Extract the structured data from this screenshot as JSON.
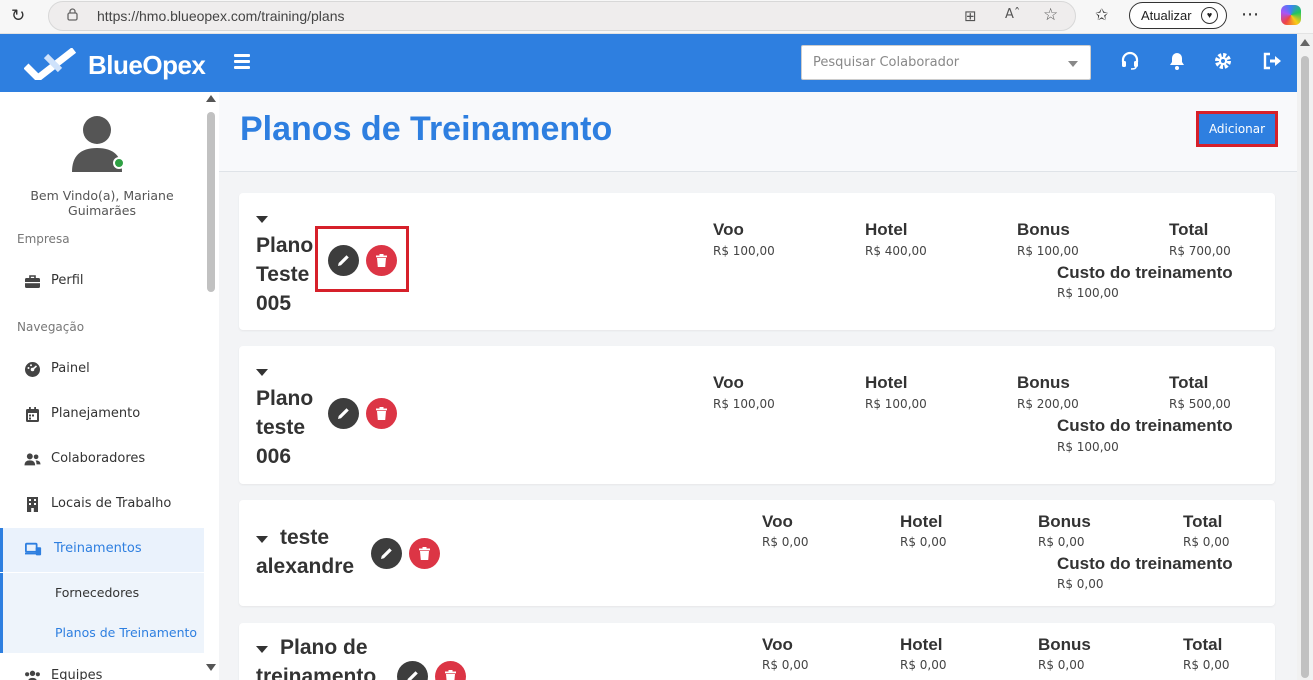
{
  "browser": {
    "url": "https://hmo.blueopex.com/training/plans",
    "update_label": "Atualizar"
  },
  "header": {
    "logo_text": "BlueOpex",
    "search_placeholder": "Pesquisar Colaborador",
    "icons": [
      "headset-icon",
      "bell-icon",
      "gear-icon",
      "logout-icon"
    ]
  },
  "sidebar": {
    "welcome": "Bem Vindo(a), Mariane Guimarães",
    "section_company": "Empresa",
    "section_nav": "Navegação",
    "items": [
      {
        "label": "Perfil",
        "icon": "briefcase-icon"
      },
      {
        "label": "Painel",
        "icon": "dashboard-icon"
      },
      {
        "label": "Planejamento",
        "icon": "calendar-icon"
      },
      {
        "label": "Colaboradores",
        "icon": "users-icon"
      },
      {
        "label": "Locais de Trabalho",
        "icon": "building-icon"
      },
      {
        "label": "Treinamentos",
        "icon": "training-icon"
      },
      {
        "label": "Equipes",
        "icon": "team-icon"
      }
    ],
    "subitems": [
      {
        "label": "Fornecedores"
      },
      {
        "label": "Planos de Treinamento"
      }
    ]
  },
  "page": {
    "title": "Planos de Treinamento",
    "add_label": "Adicionar"
  },
  "plans": [
    {
      "name_lines": [
        "Plano",
        "Teste",
        "005"
      ],
      "voo_label": "Voo",
      "voo": "R$ 100,00",
      "hotel_label": "Hotel",
      "hotel": "R$ 400,00",
      "bonus_label": "Bonus",
      "bonus": "R$ 100,00",
      "total_label": "Total",
      "total": "R$ 700,00",
      "custo_label": "Custo do treinamento",
      "custo": "R$ 100,00"
    },
    {
      "name_lines": [
        "Plano",
        "teste",
        "006"
      ],
      "voo_label": "Voo",
      "voo": "R$ 100,00",
      "hotel_label": "Hotel",
      "hotel": "R$ 100,00",
      "bonus_label": "Bonus",
      "bonus": "R$ 200,00",
      "total_label": "Total",
      "total": "R$ 500,00",
      "custo_label": "Custo do treinamento",
      "custo": "R$ 100,00"
    },
    {
      "name_lines": [
        "teste",
        "alexandre"
      ],
      "voo_label": "Voo",
      "voo": "R$ 0,00",
      "hotel_label": "Hotel",
      "hotel": "R$ 0,00",
      "bonus_label": "Bonus",
      "bonus": "R$ 0,00",
      "total_label": "Total",
      "total": "R$ 0,00",
      "custo_label": "Custo do treinamento",
      "custo": "R$ 0,00"
    },
    {
      "name_lines": [
        "Plano de",
        "treinamento"
      ],
      "voo_label": "Voo",
      "voo": "R$ 0,00",
      "hotel_label": "Hotel",
      "hotel": "R$ 0,00",
      "bonus_label": "Bonus",
      "bonus": "R$ 0,00",
      "total_label": "Total",
      "total": "R$ 0,00"
    }
  ]
}
